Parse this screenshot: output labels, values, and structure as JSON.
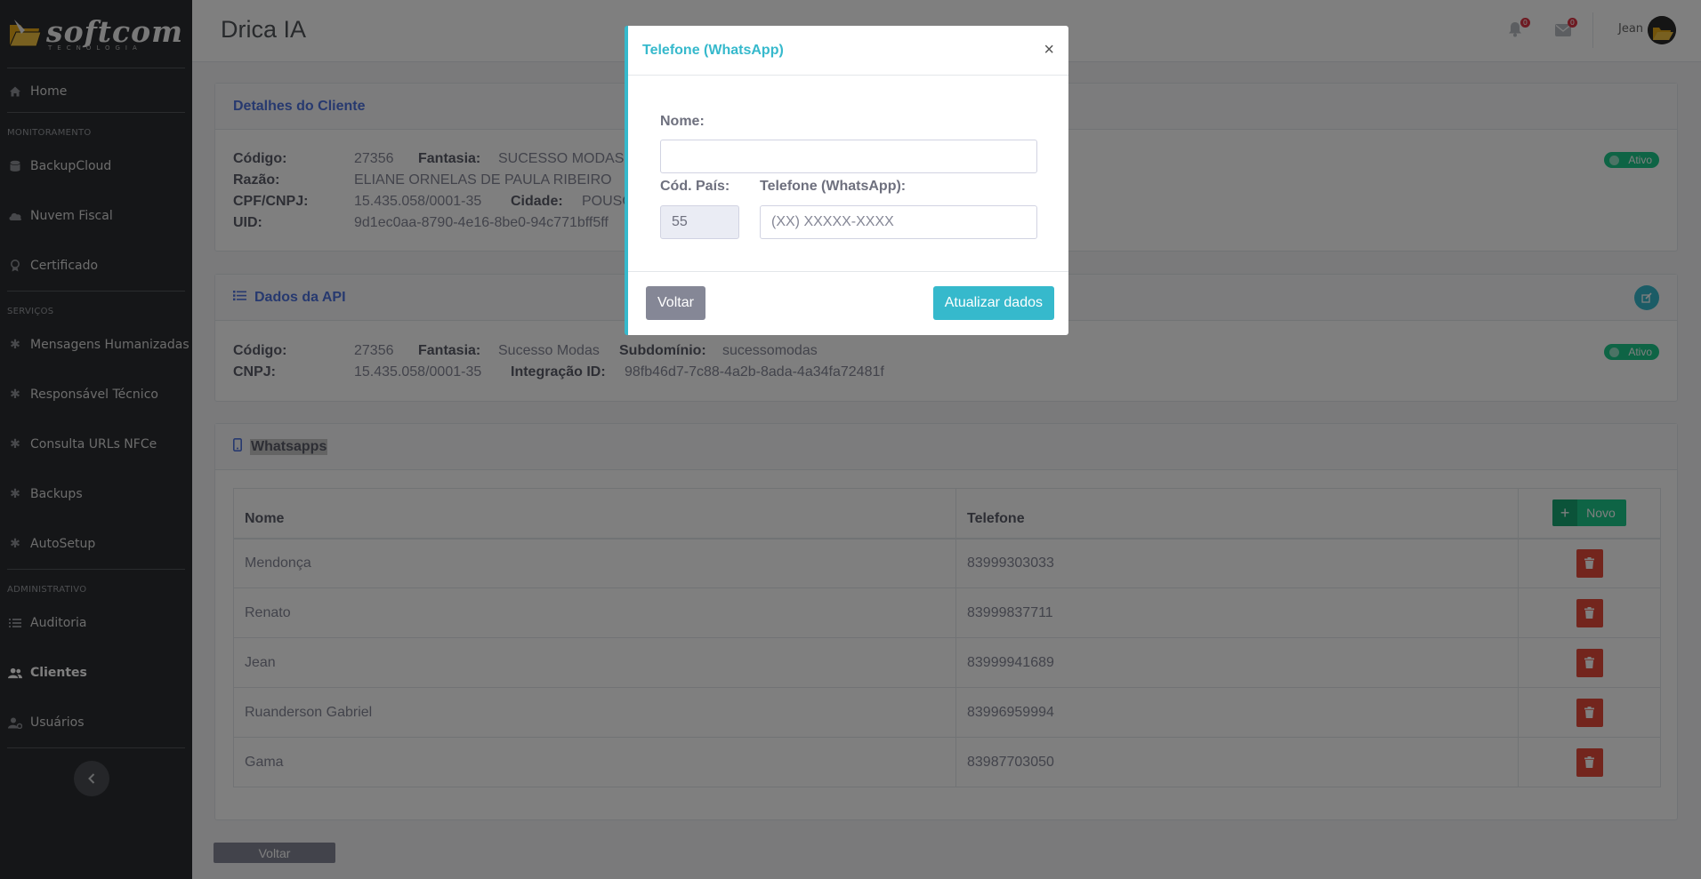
{
  "brand": {
    "logo_text": "softcom",
    "logo_sub": "TECNOLOGIA"
  },
  "sidebar": {
    "home": "Home",
    "sections": [
      {
        "title": "MONITORAMENTO",
        "items": [
          "BackupCloud",
          "Nuvem Fiscal",
          "Certificado"
        ]
      },
      {
        "title": "SERVIÇOS",
        "items": [
          "Mensagens Humanizadas",
          "Responsável Técnico",
          "Consulta URLs NFCe",
          "Backups",
          "AutoSetup"
        ]
      },
      {
        "title": "ADMINISTRATIVO",
        "items": [
          "Auditoria",
          "Clientes",
          "Usuários"
        ]
      }
    ],
    "active": "Clientes"
  },
  "topbar": {
    "title": "Drica IA",
    "notifications_count": "0",
    "messages_count": "0",
    "user": "Jean"
  },
  "client_card": {
    "title": "Detalhes do Cliente",
    "status": "Ativo",
    "codigo_label": "Código:",
    "codigo": "27356",
    "fantasia_label": "Fantasia:",
    "fantasia": "SUCESSO MODAS -",
    "razao_label": "Razão:",
    "razao": "ELIANE ORNELAS DE PAULA RIBEIRO",
    "cpf_label": "CPF/CNPJ:",
    "cpf": "15.435.058/0001-35",
    "cidade_label": "Cidade:",
    "cidade": "POUSO",
    "uid_label": "UID:",
    "uid": "9d1ec0aa-8790-4e16-8be0-94c771bff5ff"
  },
  "api_card": {
    "title": "Dados da API",
    "status": "Ativo",
    "codigo_label": "Código:",
    "codigo": "27356",
    "fantasia_label": "Fantasia:",
    "fantasia": "Sucesso Modas",
    "subdominio_label": "Subdomínio:",
    "subdominio": "sucessomodas",
    "cnpj_label": "CNPJ:",
    "cnpj": "15.435.058/0001-35",
    "integracao_label": "Integração ID:",
    "integracao": "98fb46d7-7c88-4a2b-8ada-4a34fa72481f"
  },
  "whatsapps": {
    "title": "Whatsapps",
    "col_nome": "Nome",
    "col_telefone": "Telefone",
    "novo_label": "Novo",
    "rows": [
      {
        "nome": "Mendonça",
        "telefone": "83999303033"
      },
      {
        "nome": "Renato",
        "telefone": "83999837711"
      },
      {
        "nome": "Jean",
        "telefone": "83999941689"
      },
      {
        "nome": "Ruanderson Gabriel",
        "telefone": "83996959994"
      },
      {
        "nome": "Gama",
        "telefone": "83987703050"
      }
    ]
  },
  "footer": {
    "voltar_label": "Voltar"
  },
  "modal": {
    "title": "Telefone (WhatsApp)",
    "nome_label": "Nome:",
    "nome_value": "",
    "pais_label": "Cód. País:",
    "pais_value": "55",
    "telefone_label": "Telefone (WhatsApp):",
    "telefone_placeholder": "(XX) XXXXX-XXXX",
    "voltar_label": "Voltar",
    "atualizar_label": "Atualizar dados"
  },
  "colors": {
    "primary": "#4e73df",
    "info": "#36b9cc",
    "success": "#1cc88a",
    "danger": "#e74a3b",
    "secondary": "#858796",
    "sidebar": "#2b2d30"
  }
}
